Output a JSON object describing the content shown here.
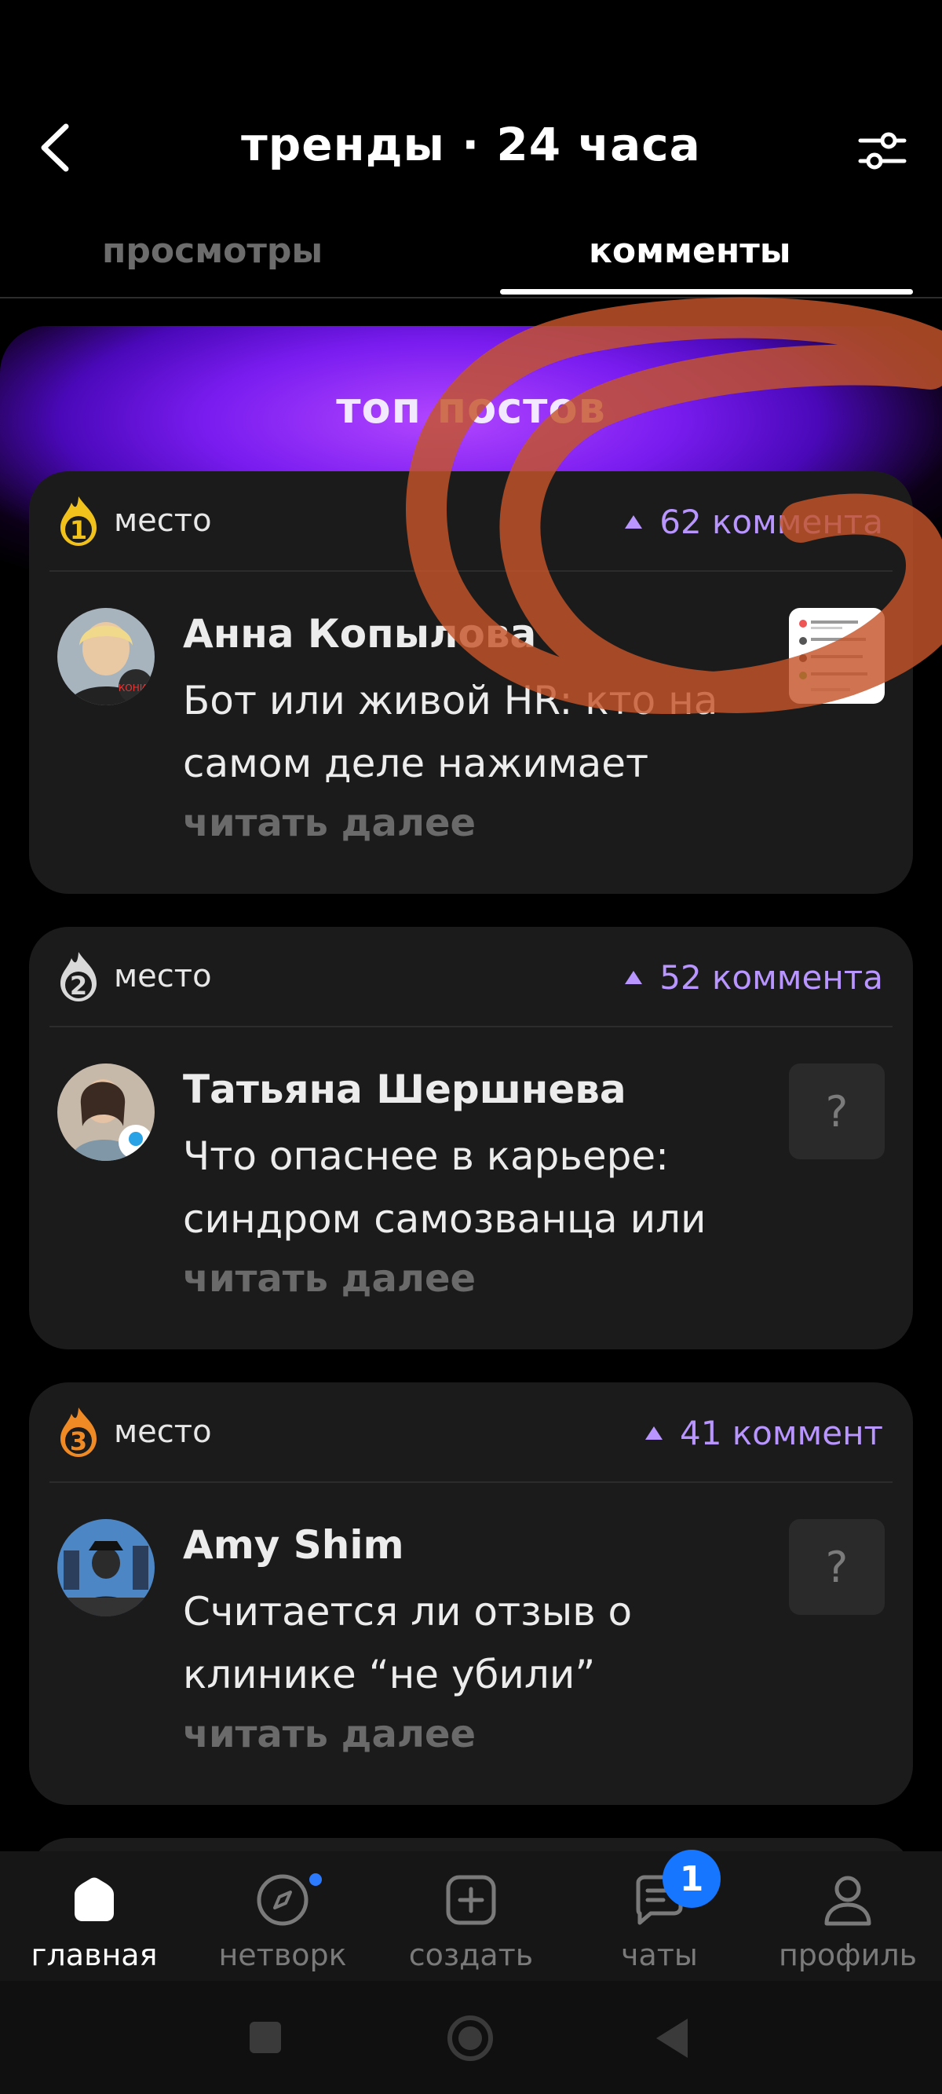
{
  "header": {
    "title": "тренды · 24 часа"
  },
  "tabs": [
    {
      "label": "просмотры",
      "active": false
    },
    {
      "label": "комменты",
      "active": true
    }
  ],
  "section": {
    "title": "топ постов"
  },
  "posts": [
    {
      "rank": "1",
      "rank_label": "место",
      "rank_color": "#f1c21b",
      "count": "62 коммента",
      "author": "Анна Копылова",
      "text": "Бот или живой HR: кто на самом деле нажимает",
      "more": "читать далее",
      "thumb": "screenshot-thumbnail"
    },
    {
      "rank": "2",
      "rank_label": "место",
      "rank_color": "#d9d9d9",
      "count": "52 коммента",
      "author": "Татьяна Шершнева",
      "text": "Что опаснее в карьере: синдром самозванца или",
      "more": "читать далее",
      "thumb": "?"
    },
    {
      "rank": "3",
      "rank_label": "место",
      "rank_color": "#f08a24",
      "count": "41 коммент",
      "author": "Amy Shim",
      "text": "Считается ли отзыв о клинике “не убили”",
      "more": "читать далее",
      "thumb": "?"
    }
  ],
  "bottom_nav": [
    {
      "label": "главная",
      "icon": "home-icon",
      "active": true
    },
    {
      "label": "нетворк",
      "icon": "compass-icon",
      "active": false
    },
    {
      "label": "создать",
      "icon": "plus-square-icon",
      "active": false
    },
    {
      "label": "чаты",
      "icon": "chat-icon",
      "active": false,
      "badge": "1"
    },
    {
      "label": "профиль",
      "icon": "person-icon",
      "active": false
    }
  ],
  "colors": {
    "accent_purple": "#b895ff",
    "badge_blue": "#1676ff",
    "scribble": "#c5542a"
  }
}
